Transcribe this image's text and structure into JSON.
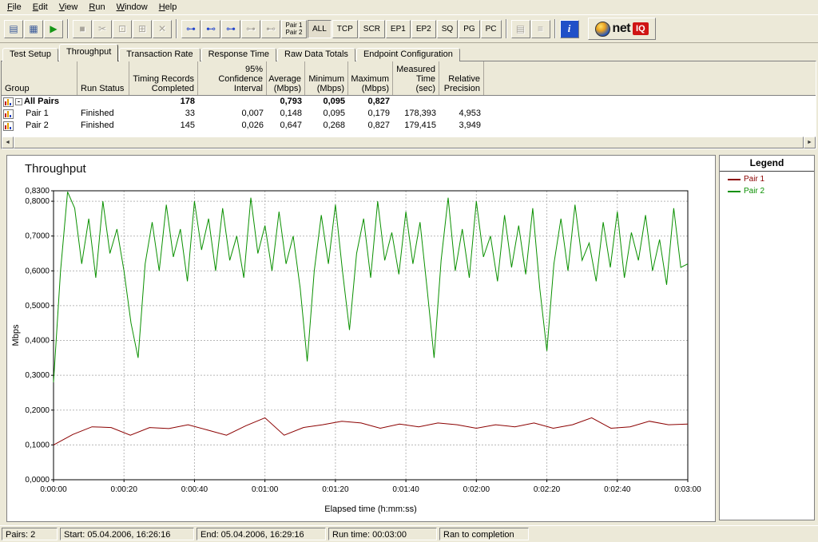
{
  "menu": {
    "items": [
      "File",
      "Edit",
      "View",
      "Run",
      "Window",
      "Help"
    ]
  },
  "toolbar": {
    "buttons": [
      {
        "type": "icon",
        "name": "new-test-button",
        "glyph": "▤",
        "color": "#3a5a9a",
        "disabled": false
      },
      {
        "type": "icon",
        "name": "print-button",
        "glyph": "▦",
        "color": "#3a5a9a",
        "disabled": false
      },
      {
        "type": "icon",
        "name": "run-test-button",
        "glyph": "▶",
        "color": "#169616",
        "disabled": false
      },
      {
        "type": "sep"
      },
      {
        "type": "icon",
        "name": "stop-run-button",
        "glyph": "■",
        "disabled": true
      },
      {
        "type": "icon",
        "name": "cut-button",
        "glyph": "✂",
        "disabled": true
      },
      {
        "type": "icon",
        "name": "copy-button",
        "glyph": "⊡",
        "disabled": true
      },
      {
        "type": "icon",
        "name": "paste-button",
        "glyph": "⊞",
        "disabled": true
      },
      {
        "type": "icon",
        "name": "delete-button",
        "glyph": "✕",
        "disabled": true
      },
      {
        "type": "sep"
      },
      {
        "type": "icon",
        "name": "add-pair-button",
        "glyph": "⊶",
        "color": "#2244cc",
        "disabled": false
      },
      {
        "type": "icon",
        "name": "add-multicast-pair-button",
        "glyph": "⊷",
        "color": "#2244cc",
        "disabled": false
      },
      {
        "type": "icon",
        "name": "edit-pair-button",
        "glyph": "⊶",
        "color": "#2244cc",
        "disabled": false
      },
      {
        "type": "icon",
        "name": "swap-endpoints-button",
        "glyph": "⊶",
        "disabled": true
      },
      {
        "type": "icon",
        "name": "view-pair-button",
        "glyph": "⊷",
        "disabled": true
      },
      {
        "type": "stacked",
        "name": "pair-visibility-button",
        "lines": [
          "Pair 1",
          "Pair 2"
        ],
        "disabled": false
      },
      {
        "type": "text",
        "name": "filter-all-button",
        "label": "ALL",
        "pressed": true,
        "disabled": false
      },
      {
        "type": "text",
        "name": "filter-tcp-button",
        "label": "TCP",
        "disabled": false
      },
      {
        "type": "text",
        "name": "filter-scr-button",
        "label": "SCR",
        "disabled": false
      },
      {
        "type": "text",
        "name": "filter-ep1-button",
        "label": "EP1",
        "disabled": false
      },
      {
        "type": "text",
        "name": "filter-ep2-button",
        "label": "EP2",
        "disabled": false
      },
      {
        "type": "text",
        "name": "filter-sq-button",
        "label": "SQ",
        "disabled": false
      },
      {
        "type": "text",
        "name": "filter-pg-button",
        "label": "PG",
        "disabled": false
      },
      {
        "type": "text",
        "name": "filter-pc-button",
        "label": "PC",
        "disabled": false
      },
      {
        "type": "sep"
      },
      {
        "type": "icon",
        "name": "report-view-button",
        "glyph": "▤",
        "disabled": true
      },
      {
        "type": "icon",
        "name": "notes-view-button",
        "glyph": "≡",
        "disabled": true
      },
      {
        "type": "sep"
      },
      {
        "type": "info",
        "name": "info-button",
        "glyph": "i",
        "disabled": false
      }
    ],
    "logo": {
      "text": "net",
      "badge": "IQ"
    }
  },
  "tabs": {
    "items": [
      {
        "label": "Test Setup",
        "active": false
      },
      {
        "label": "Throughput",
        "active": true
      },
      {
        "label": "Transaction Rate",
        "active": false
      },
      {
        "label": "Response Time",
        "active": false
      },
      {
        "label": "Raw Data Totals",
        "active": false
      },
      {
        "label": "Endpoint Configuration",
        "active": false
      }
    ]
  },
  "table": {
    "columns": [
      {
        "key": "group",
        "label": "Group"
      },
      {
        "key": "run_status",
        "label": "Run Status"
      },
      {
        "key": "timing_records",
        "label": "Timing Records\nCompleted"
      },
      {
        "key": "confidence",
        "label": "95% Confidence\nInterval"
      },
      {
        "key": "average",
        "label": "Average\n(Mbps)"
      },
      {
        "key": "minimum",
        "label": "Minimum\n(Mbps)"
      },
      {
        "key": "maximum",
        "label": "Maximum\n(Mbps)"
      },
      {
        "key": "measured_time",
        "label": "Measured\nTime (sec)"
      },
      {
        "key": "precision",
        "label": "Relative\nPrecision"
      }
    ],
    "rows": [
      {
        "group": "All Pairs",
        "bold": true,
        "expand": true,
        "run_status": "",
        "timing_records": "178",
        "confidence": "",
        "average": "0,793",
        "minimum": "0,095",
        "maximum": "0,827",
        "measured_time": "",
        "precision": ""
      },
      {
        "group": "Pair 1",
        "bold": false,
        "expand": false,
        "run_status": "Finished",
        "timing_records": "33",
        "confidence": "0,007",
        "average": "0,148",
        "minimum": "0,095",
        "maximum": "0,179",
        "measured_time": "178,393",
        "precision": "4,953"
      },
      {
        "group": "Pair 2",
        "bold": false,
        "expand": false,
        "run_status": "Finished",
        "timing_records": "145",
        "confidence": "0,026",
        "average": "0,647",
        "minimum": "0,268",
        "maximum": "0,827",
        "measured_time": "179,415",
        "precision": "3,949"
      }
    ]
  },
  "chart_data": {
    "type": "line",
    "title": "Throughput",
    "xlabel": "Elapsed time (h:mm:ss)",
    "ylabel": "Mbps",
    "ylim": [
      0,
      0.83
    ],
    "xlim_seconds": [
      0,
      180
    ],
    "grid": true,
    "legend_position": "right",
    "y_ticks": [
      {
        "label": "0,8300",
        "value": 0.83
      },
      {
        "label": "0,8000",
        "value": 0.8
      },
      {
        "label": "0,7000",
        "value": 0.7
      },
      {
        "label": "0,6000",
        "value": 0.6
      },
      {
        "label": "0,5000",
        "value": 0.5
      },
      {
        "label": "0,4000",
        "value": 0.4
      },
      {
        "label": "0,3000",
        "value": 0.3
      },
      {
        "label": "0,2000",
        "value": 0.2
      },
      {
        "label": "0,1000",
        "value": 0.1
      },
      {
        "label": "0,0000",
        "value": 0.0
      }
    ],
    "x_ticks": [
      {
        "label": "0:00:00",
        "value": 0
      },
      {
        "label": "0:00:20",
        "value": 20
      },
      {
        "label": "0:00:40",
        "value": 40
      },
      {
        "label": "0:01:00",
        "value": 60
      },
      {
        "label": "0:01:20",
        "value": 80
      },
      {
        "label": "0:01:40",
        "value": 100
      },
      {
        "label": "0:02:00",
        "value": 120
      },
      {
        "label": "0:02:20",
        "value": 140
      },
      {
        "label": "0:02:40",
        "value": 160
      },
      {
        "label": "0:03:00",
        "value": 180
      }
    ],
    "series": [
      {
        "name": "Pair 1",
        "color": "#8b0000",
        "values": [
          0.1,
          0.13,
          0.152,
          0.15,
          0.128,
          0.15,
          0.147,
          0.158,
          0.143,
          0.128,
          0.155,
          0.178,
          0.128,
          0.15,
          0.158,
          0.168,
          0.163,
          0.148,
          0.16,
          0.152,
          0.163,
          0.158,
          0.148,
          0.158,
          0.152,
          0.163,
          0.148,
          0.158,
          0.178,
          0.148,
          0.152,
          0.168,
          0.158,
          0.16
        ]
      },
      {
        "name": "Pair 2",
        "color": "#0a9000",
        "values": [
          0.28,
          0.6,
          0.827,
          0.78,
          0.62,
          0.75,
          0.58,
          0.8,
          0.65,
          0.72,
          0.6,
          0.45,
          0.35,
          0.62,
          0.74,
          0.6,
          0.79,
          0.64,
          0.72,
          0.57,
          0.8,
          0.66,
          0.75,
          0.6,
          0.78,
          0.63,
          0.7,
          0.58,
          0.81,
          0.65,
          0.73,
          0.6,
          0.77,
          0.62,
          0.7,
          0.55,
          0.34,
          0.6,
          0.76,
          0.62,
          0.79,
          0.6,
          0.43,
          0.65,
          0.75,
          0.58,
          0.8,
          0.63,
          0.71,
          0.59,
          0.77,
          0.62,
          0.74,
          0.55,
          0.35,
          0.63,
          0.81,
          0.6,
          0.72,
          0.58,
          0.8,
          0.64,
          0.7,
          0.57,
          0.76,
          0.61,
          0.73,
          0.59,
          0.78,
          0.55,
          0.37,
          0.62,
          0.75,
          0.6,
          0.79,
          0.63,
          0.68,
          0.57,
          0.74,
          0.61,
          0.77,
          0.58,
          0.71,
          0.63,
          0.76,
          0.6,
          0.69,
          0.56,
          0.78,
          0.61,
          0.62
        ]
      }
    ]
  },
  "legend": {
    "title": "Legend",
    "items": [
      {
        "label": "Pair 1",
        "color": "#8b0000"
      },
      {
        "label": "Pair 2",
        "color": "#0a9000"
      }
    ]
  },
  "statusbar": {
    "cells": [
      "Pairs: 2",
      "Start: 05.04.2006, 16:26:16",
      "End: 05.04.2006, 16:29:16",
      "Run time: 00:03:00",
      "Ran to completion"
    ]
  }
}
